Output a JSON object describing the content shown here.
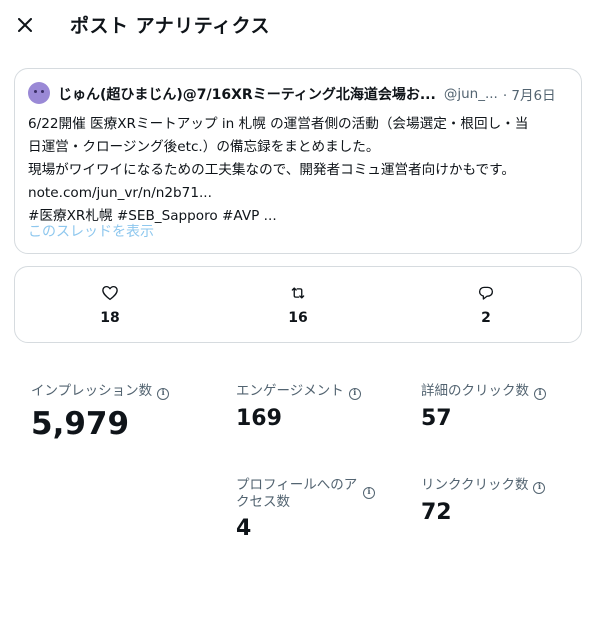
{
  "header": {
    "close_icon": "close-icon",
    "title": "ポスト アナリティクス"
  },
  "tweet": {
    "avatar_icon": "avatar",
    "author_name": "じゅん(超ひまじん)@7/16XRミーティング北海道会場お...",
    "handle": "@jun_...",
    "date": "· 7月6日",
    "lines": [
      "6/22開催 医療XRミートアップ in 札幌 の運営者側の活動（会場選定・根回し・当",
      "日運営・クロージング後etc.）の備忘録をまとめました。",
      "現場がワイワイになるための工夫集なので、開発者コミュ運営者向けかもです。",
      "note.com/jun_vr/n/n2b71...",
      "#医療XR札幌 #SEB_Sapporo #AVP ..."
    ],
    "thread_link": "このスレッドを表示"
  },
  "engagement": {
    "likes": "18",
    "retweets": "16",
    "replies": "2",
    "icons": [
      "heart-icon",
      "retweet-icon",
      "reply-icon"
    ]
  },
  "metrics": {
    "impressions": {
      "label": "インプレッション数",
      "value": "5,979"
    },
    "engagements": {
      "label": "エンゲージメント",
      "value": "169"
    },
    "detail_clicks": {
      "label": "詳細のクリック数",
      "value": "57"
    },
    "profile_visits": {
      "label_line1": "プロフィールへのア",
      "label_line2": "クセス数",
      "value": "4"
    },
    "link_clicks": {
      "label": "リンククリック数",
      "value": "72"
    },
    "info_icon": "info-icon"
  },
  "colors": {
    "text": "#0f1419",
    "secondary": "#536471",
    "border": "#d6dbdf",
    "link": "#8ec7ee",
    "avatar": "#9a89d6"
  }
}
